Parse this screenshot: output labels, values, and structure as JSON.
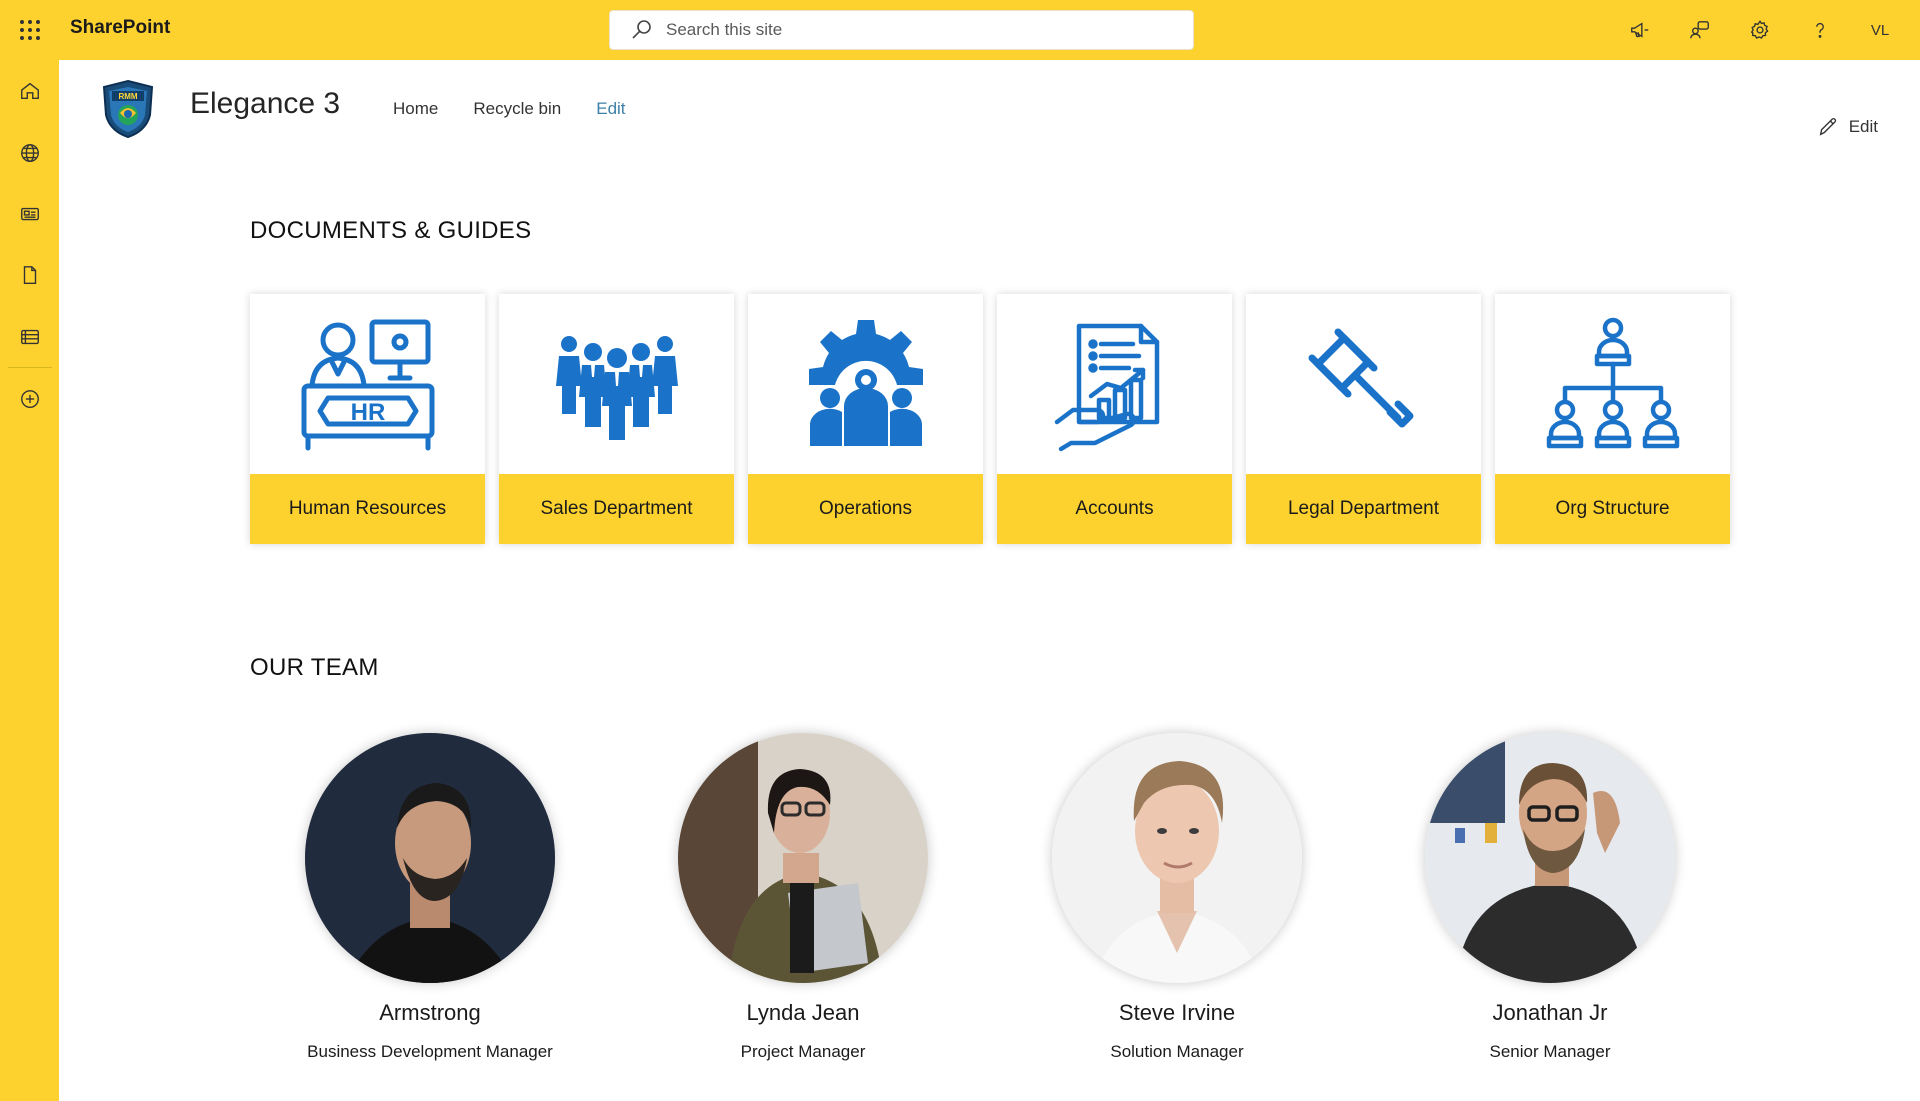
{
  "suite": {
    "app_name": "SharePoint",
    "search_placeholder": "Search this site",
    "user_initials": "VL",
    "colors": {
      "bar": "#fdd22f",
      "icon_blue": "#1a73c8"
    }
  },
  "rail": {
    "items": [
      {
        "name": "home-icon"
      },
      {
        "name": "globe-icon"
      },
      {
        "name": "news-icon"
      },
      {
        "name": "file-icon"
      },
      {
        "name": "list-icon"
      },
      {
        "name": "add-circle-icon"
      }
    ]
  },
  "site": {
    "logo_text": "RMM",
    "title": "Elegance 3",
    "nav": [
      {
        "label": "Home"
      },
      {
        "label": "Recycle bin"
      },
      {
        "label": "Edit"
      }
    ],
    "edit_label": "Edit"
  },
  "documents": {
    "heading": "DOCUMENTS & GUIDES",
    "tiles": [
      {
        "label": "Human Resources",
        "icon": "hr-desk-icon",
        "icon_text": "HR"
      },
      {
        "label": "Sales Department",
        "icon": "team-people-icon"
      },
      {
        "label": "Operations",
        "icon": "gear-team-icon"
      },
      {
        "label": "Accounts",
        "icon": "report-chart-icon"
      },
      {
        "label": "Legal Department",
        "icon": "gavel-icon"
      },
      {
        "label": "Org Structure",
        "icon": "org-chart-icon"
      }
    ]
  },
  "team": {
    "heading": "OUR TEAM",
    "members": [
      {
        "name": "Armstrong",
        "role": "Business Development Manager"
      },
      {
        "name": "Lynda Jean",
        "role": "Project Manager"
      },
      {
        "name": "Steve Irvine",
        "role": "Solution Manager"
      },
      {
        "name": "Jonathan Jr",
        "role": "Senior Manager"
      }
    ]
  }
}
